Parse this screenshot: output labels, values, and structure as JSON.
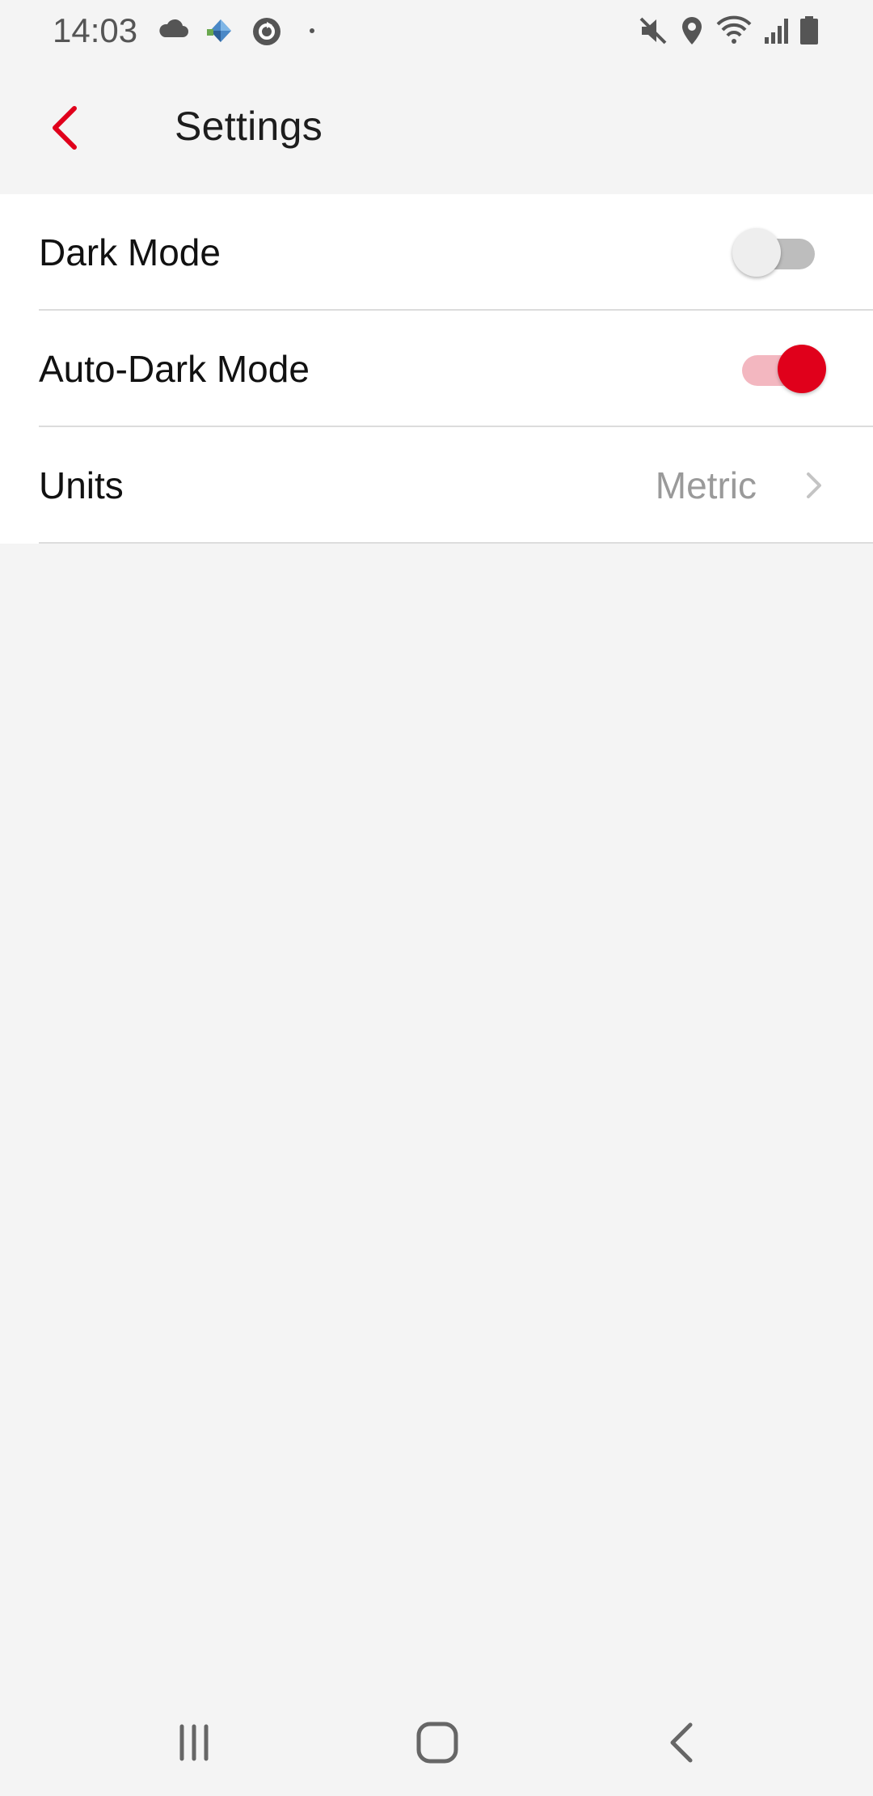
{
  "status_bar": {
    "time": "14:03",
    "left_icons": [
      "cloud-icon",
      "app-notification-icon",
      "sync-icon",
      "dot-icon"
    ],
    "right_icons": [
      "mute-icon",
      "location-icon",
      "wifi-icon",
      "signal-icon",
      "battery-icon"
    ]
  },
  "app_bar": {
    "title": "Settings",
    "back_icon": "chevron-left-icon"
  },
  "settings": {
    "dark_mode": {
      "label": "Dark Mode",
      "enabled": false
    },
    "auto_dark_mode": {
      "label": "Auto-Dark Mode",
      "enabled": true
    },
    "units": {
      "label": "Units",
      "value": "Metric"
    }
  },
  "nav_bar": {
    "buttons": [
      "recent-apps-icon",
      "home-icon",
      "back-icon"
    ]
  },
  "colors": {
    "accent": "#e0001b",
    "accent_light": "#f3b7c0",
    "background": "#f4f4f4",
    "card": "#ffffff",
    "divider": "#dcdcdc",
    "secondary_text": "#9a9a9a"
  }
}
